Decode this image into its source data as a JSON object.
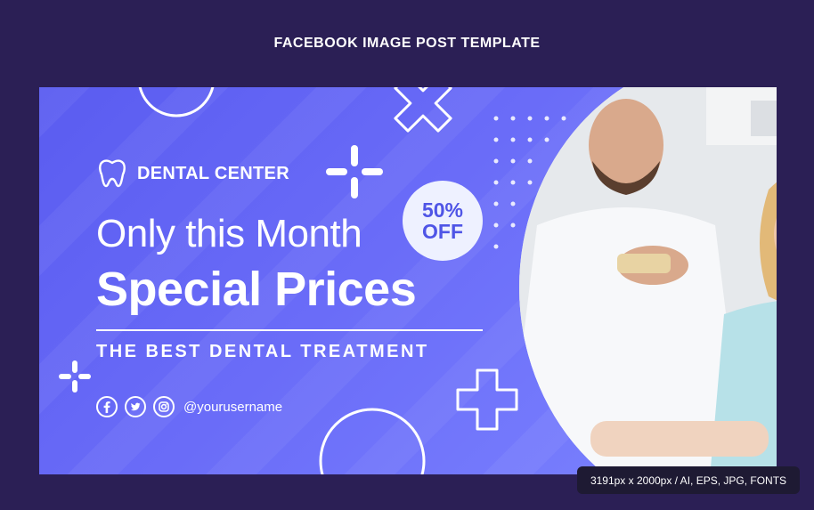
{
  "page_title": "FACEBOOK IMAGE POST TEMPLATE",
  "banner": {
    "brand_name": "DENTAL CENTER",
    "headline_line1": "Only this Month",
    "headline_line2": "Special Prices",
    "tagline": "THE BEST DENTAL TREATMENT",
    "badge_top": "50%",
    "badge_bottom": "OFF",
    "social_handle": "@yourusername",
    "social_icons": [
      "facebook-icon",
      "twitter-icon",
      "instagram-icon"
    ]
  },
  "info_pill": "3191px x 2000px / AI, EPS, JPG, FONTS",
  "colors": {
    "page_background": "#2b1f55",
    "banner_gradient_start": "#5a5cf0",
    "banner_gradient_end": "#7c84ff",
    "badge_background": "#eef1ff",
    "badge_text": "#4f55e6"
  }
}
